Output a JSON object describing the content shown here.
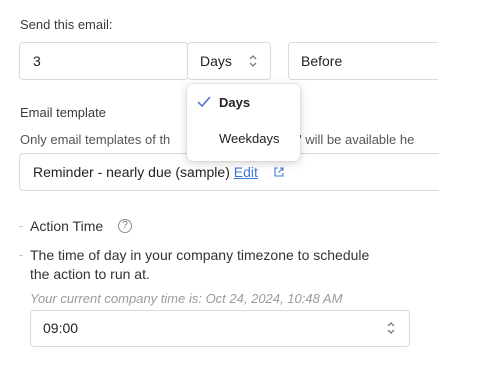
{
  "send_email": {
    "label": "Send this email:",
    "quantity_value": "3",
    "unit_selected": "Days",
    "timing_selected": "Before"
  },
  "unit_menu": {
    "options": [
      {
        "label": "Days",
        "selected": true
      },
      {
        "label": "Weekdays",
        "selected": false
      }
    ]
  },
  "email_template": {
    "label": "Email template",
    "help_left": "Only email templates of th",
    "help_right": "\" will be available he",
    "selected_value": "Reminder - nearly due (sample)",
    "edit_label": "Edit"
  },
  "action_time": {
    "label": "Action Time",
    "description_line1": "The time of day in your company timezone to schedule",
    "description_line2": "the action to run at.",
    "current_time_note": "Your current company time is: Oct 24, 2024, 10:48 AM",
    "selected_time": "09:00"
  },
  "colors": {
    "link": "#3b7ad9",
    "border": "#d9d9de"
  }
}
